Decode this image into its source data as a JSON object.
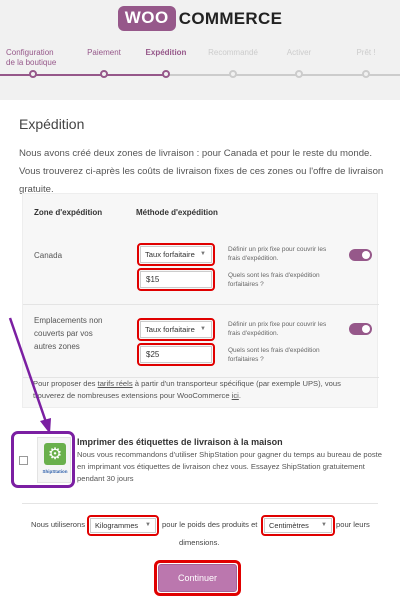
{
  "brand": {
    "woo": "WOO",
    "commerce": "COMMERCE"
  },
  "steps": [
    {
      "label": "Configuration\nde la boutique",
      "state": "done"
    },
    {
      "label": "Paiement",
      "state": "done"
    },
    {
      "label": "Expédition",
      "state": "active"
    },
    {
      "label": "Recommandé",
      "state": "todo"
    },
    {
      "label": "Activer",
      "state": "todo"
    },
    {
      "label": "Prêt !",
      "state": "todo"
    }
  ],
  "page": {
    "title": "Expédition",
    "intro": "Nous avons créé deux zones de livraison : pour Canada et pour le reste du monde. Vous trouverez ci-après les coûts de livraison fixes de ces zones ou l'offre de livraison gratuite."
  },
  "zones": {
    "header_zone": "Zone d'expédition",
    "header_method": "Méthode d'expédition",
    "rows": [
      {
        "name": "Canada",
        "method": "Taux forfaitaire",
        "price": "$15",
        "hint1": "Définir un prix fixe pour couvrir les frais d'expédition.",
        "hint2": "Quels sont les frais d'expédition forfaitaires ?",
        "enabled": true
      },
      {
        "name": "Emplacements non couverts par vos autres zones",
        "method": "Taux forfaitaire",
        "price": "$25",
        "hint1": "Définir un prix fixe pour couvrir les frais d'expédition.",
        "hint2": "Quels sont les frais d'expédition forfaitaires ?",
        "enabled": true
      }
    ],
    "note_pre": "Pour proposer des ",
    "note_link": "tarifs réels",
    "note_mid": " à partir d'un transporteur spécifique (par exemple UPS), vous trouverez de nombreuses extensions pour WooCommerce ",
    "note_link2": "ici",
    "note_post": "."
  },
  "shipstation": {
    "logo_text": "ShipStation",
    "title": "Imprimer des étiquettes de livraison à la maison",
    "desc": "Nous vous recommandons d'utiliser ShipStation pour gagner du temps au bureau de poste en imprimant vos étiquettes de livraison chez vous. Essayez ShipStation gratuitement pendant 30 jours",
    "checked": false
  },
  "units": {
    "pre": "Nous utiliserons",
    "weight": "Kilogrammes",
    "mid": "pour le poids des produits et",
    "dimension": "Centimètres",
    "post": "pour leurs",
    "post2": "dimensions."
  },
  "continue_label": "Continuer",
  "colors": {
    "brand": "#96588a",
    "highlight": "#e00000",
    "annotation": "#7b1fa2",
    "button": "#bb77ae"
  }
}
